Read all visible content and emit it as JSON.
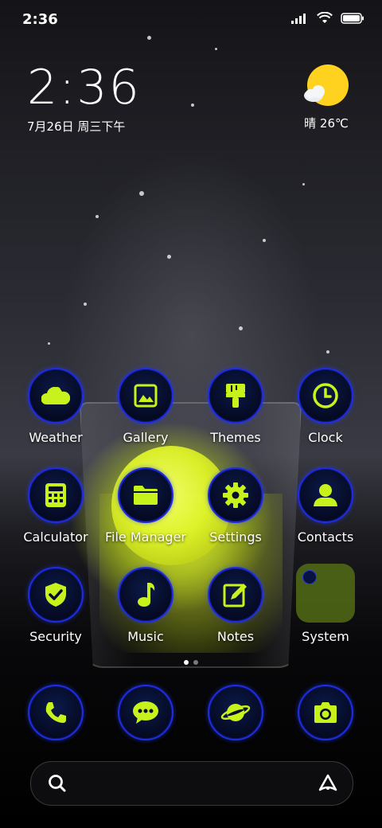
{
  "status_bar": {
    "time": "2:36",
    "icons": [
      "signal-icon",
      "wifi-icon",
      "battery-icon"
    ]
  },
  "clock_widget": {
    "time": "2:36",
    "date": "7月26日 周三下午"
  },
  "weather_widget": {
    "icon": "partly-sunny-icon",
    "condition_temp": "晴 26℃"
  },
  "apps": [
    {
      "label": "Weather",
      "icon": "weather-icon"
    },
    {
      "label": "Gallery",
      "icon": "gallery-icon"
    },
    {
      "label": "Themes",
      "icon": "brush-icon"
    },
    {
      "label": "Clock",
      "icon": "clock-icon"
    },
    {
      "label": "Calculator",
      "icon": "calculator-icon"
    },
    {
      "label": "File Manager",
      "icon": "folder-icon"
    },
    {
      "label": "Settings",
      "icon": "gear-icon"
    },
    {
      "label": "Contacts",
      "icon": "person-icon"
    },
    {
      "label": "Security",
      "icon": "shield-check-icon"
    },
    {
      "label": "Music",
      "icon": "music-note-icon"
    },
    {
      "label": "Notes",
      "icon": "edit-note-icon"
    },
    {
      "label": "System",
      "icon": "folder-group-icon"
    }
  ],
  "dock": [
    {
      "icon": "phone-icon"
    },
    {
      "icon": "message-icon"
    },
    {
      "icon": "browser-planet-icon"
    },
    {
      "icon": "camera-icon"
    }
  ],
  "page_indicator": {
    "pages": 2,
    "current": 1
  },
  "search_bar": {
    "left_icon": "search-icon",
    "right_icon": "assistant-icon"
  },
  "colors": {
    "accent": "#C8F21B",
    "icon_ring": "#1D2DDF",
    "icon_bg": "#060C2A",
    "sun": "#FFD21F"
  }
}
